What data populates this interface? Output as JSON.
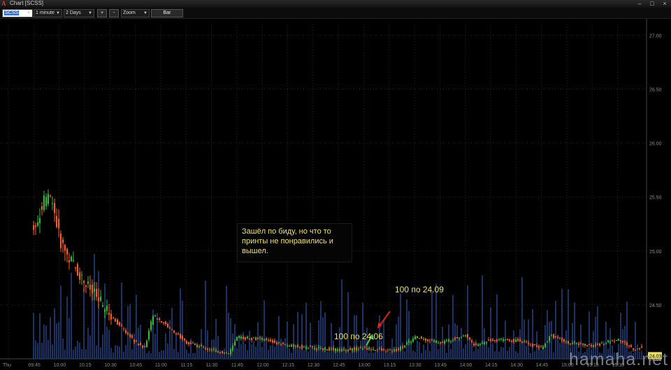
{
  "window": {
    "title": "Chart [SCSS]",
    "icon": "A"
  },
  "toolbar": {
    "symbol": "SCSS",
    "interval": "1 minute",
    "range": "2 Days",
    "plus": "+",
    "minus": "-",
    "zoom": "Zoom",
    "bar": "Bar"
  },
  "annotations": {
    "note_lines": [
      "Зашёл по биду, но что то",
      "принты не понравились и",
      "вышел."
    ],
    "sell_label": "100 по 24.09",
    "buy_label": "100 по 24.06"
  },
  "watermark": "hamaha.net",
  "colors": {
    "up": "#2fbf3a",
    "down": "#ff5a1f",
    "volume": "#1d3c78",
    "grid": "#262626",
    "axis_text": "#8a8a8a",
    "sell_arrow": "#e02020",
    "buy_arrow": "#40d040",
    "last_price_tag": "#f0e060"
  },
  "chart_data": {
    "type": "candlestick",
    "y_axis": {
      "ylim": [
        24.0,
        27.1
      ],
      "ticks": [
        "27.00",
        "26.50",
        "26.00",
        "25.50",
        "25.00",
        "24.50",
        "24.00"
      ]
    },
    "last_price": "24.03",
    "x_axis": {
      "ticks": [
        "Thu",
        "09:45",
        "10:00",
        "10:15",
        "10:30",
        "10:45",
        "11:00",
        "11:15",
        "11:30",
        "11:45",
        "12:00",
        "12:15",
        "12:30",
        "12:45",
        "13:00",
        "13:15",
        "13:30",
        "13:45",
        "14:00",
        "14:15",
        "14:30",
        "14:45",
        "15:00",
        "15:15",
        "15:30"
      ]
    },
    "price_path": [
      [
        "09:00",
        26.55
      ],
      [
        "09:05",
        26.8
      ],
      [
        "09:10",
        26.65
      ],
      [
        "09:15",
        26.6
      ],
      [
        "09:45",
        25.2
      ],
      [
        "09:50",
        25.45
      ],
      [
        "09:55",
        25.5
      ],
      [
        "10:00",
        25.1
      ],
      [
        "10:05",
        24.95
      ],
      [
        "10:15",
        24.7
      ],
      [
        "10:30",
        24.4
      ],
      [
        "10:45",
        24.15
      ],
      [
        "10:50",
        24.1
      ],
      [
        "10:55",
        24.4
      ],
      [
        "11:00",
        24.35
      ],
      [
        "11:15",
        24.15
      ],
      [
        "11:30",
        24.08
      ],
      [
        "11:40",
        24.05
      ],
      [
        "11:45",
        24.2
      ],
      [
        "12:00",
        24.18
      ],
      [
        "12:15",
        24.12
      ],
      [
        "12:30",
        24.1
      ],
      [
        "12:45",
        24.08
      ],
      [
        "13:00",
        24.1
      ],
      [
        "13:15",
        24.07
      ],
      [
        "13:20",
        24.09
      ],
      [
        "13:30",
        24.2
      ],
      [
        "13:45",
        24.15
      ],
      [
        "14:00",
        24.22
      ],
      [
        "14:05",
        24.12
      ],
      [
        "14:15",
        24.18
      ],
      [
        "14:30",
        24.17
      ],
      [
        "14:45",
        24.1
      ],
      [
        "14:50",
        24.22
      ],
      [
        "15:00",
        24.15
      ],
      [
        "15:15",
        24.12
      ],
      [
        "15:30",
        24.18
      ],
      [
        "15:40",
        24.08
      ],
      [
        "15:45",
        24.12
      ]
    ]
  }
}
